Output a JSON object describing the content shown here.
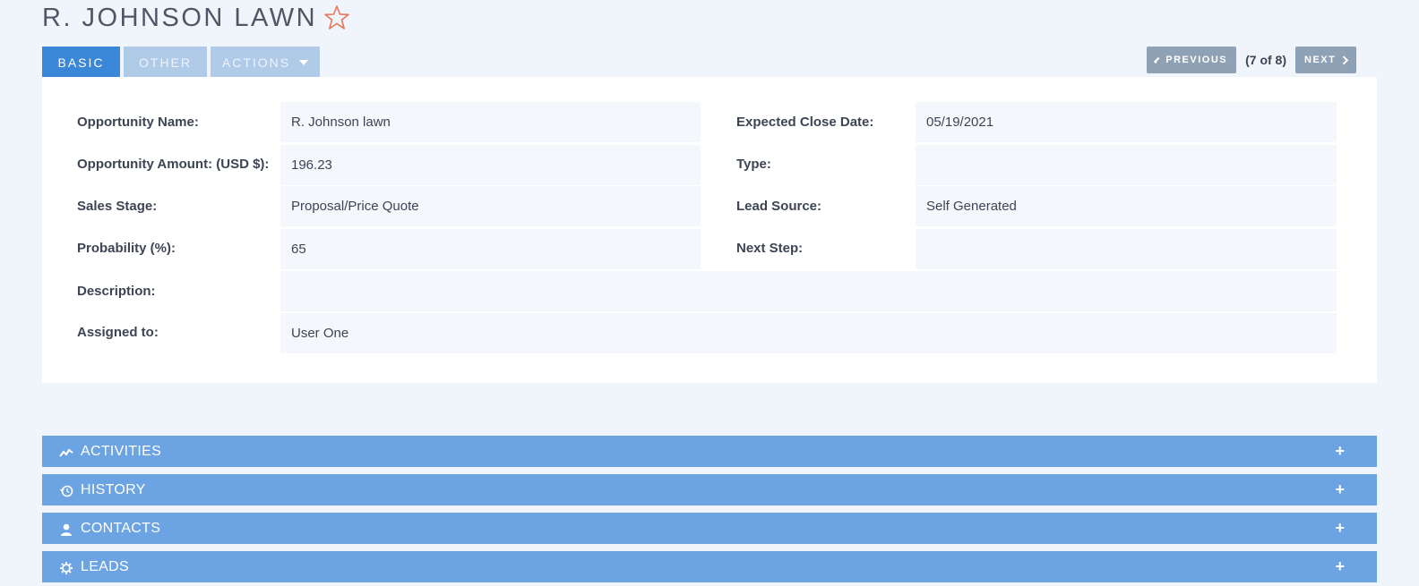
{
  "record": {
    "title": "R. JOHNSON LAWN"
  },
  "tabs": [
    {
      "label": "BASIC",
      "active": true
    },
    {
      "label": "OTHER",
      "active": false
    },
    {
      "label": "ACTIONS",
      "active": false
    }
  ],
  "pager": {
    "prev_label": "PREVIOUS",
    "count": "(7 of 8)",
    "next_label": "NEXT"
  },
  "fields": {
    "opportunity_name": {
      "label": "Opportunity Name:",
      "value": "R. Johnson lawn"
    },
    "expected_close_date": {
      "label": "Expected Close Date:",
      "value": "05/19/2021"
    },
    "opportunity_amount": {
      "label": "Opportunity Amount: (USD $):",
      "value": "196.23"
    },
    "type": {
      "label": "Type:",
      "value": ""
    },
    "sales_stage": {
      "label": "Sales Stage:",
      "value": "Proposal/Price Quote"
    },
    "lead_source": {
      "label": "Lead Source:",
      "value": "Self Generated"
    },
    "probability": {
      "label": "Probability (%):",
      "value": "65"
    },
    "next_step": {
      "label": "Next Step:",
      "value": ""
    },
    "description": {
      "label": "Description:",
      "value": ""
    },
    "assigned_to": {
      "label": "Assigned to:",
      "value": "User One"
    }
  },
  "subpanels": [
    {
      "label": "ACTIVITIES",
      "icon": "activity-chart-icon"
    },
    {
      "label": "HISTORY",
      "icon": "history-clock-icon"
    },
    {
      "label": "CONTACTS",
      "icon": "person-icon"
    },
    {
      "label": "LEADS",
      "icon": "gear-icon"
    }
  ],
  "colors": {
    "accent": "#3a87d8",
    "subpanel_bg": "#6ca4e3",
    "star": "#e8765c"
  }
}
